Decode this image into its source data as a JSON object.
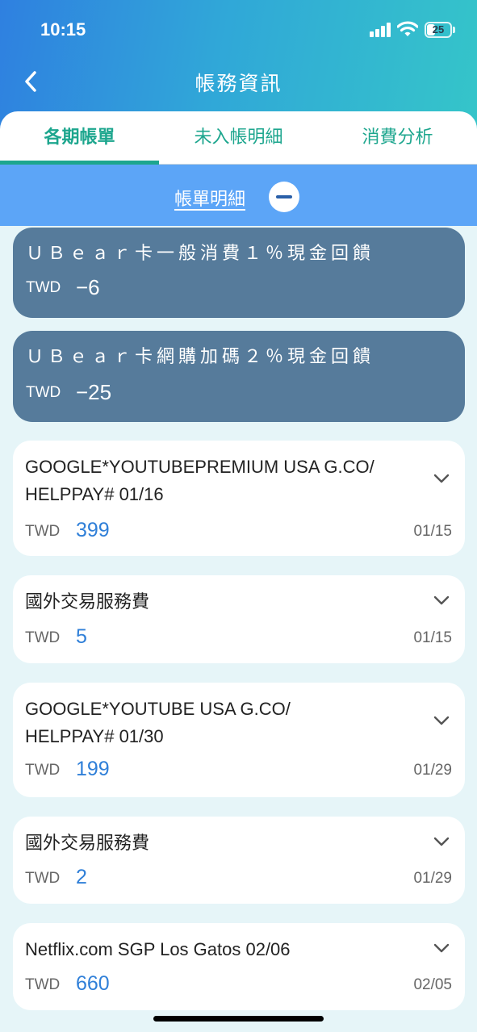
{
  "status_bar": {
    "time": "10:15",
    "battery_level": "25",
    "icons": [
      "signal-icon",
      "wifi-icon",
      "battery-icon"
    ]
  },
  "nav": {
    "title": "帳務資訊",
    "back_icon": "chevron-left-icon"
  },
  "tabs": [
    {
      "label": "各期帳單",
      "active": true
    },
    {
      "label": "未入帳明細",
      "active": false
    },
    {
      "label": "消費分析",
      "active": false
    }
  ],
  "section": {
    "label": "帳單明細",
    "toggle_icon": "minus-circle-icon"
  },
  "rewards": [
    {
      "title": "ＵＢｅａｒ卡一般消費１％現金回饋",
      "currency": "TWD",
      "amount": "−6"
    },
    {
      "title": "ＵＢｅａｒ卡網購加碼２％現金回饋",
      "currency": "TWD",
      "amount": "−25"
    }
  ],
  "transactions": [
    {
      "desc_line1": "GOOGLE*YOUTUBEPREMIUM USA G.CO/",
      "desc_line2": "HELPPAY# 01/16",
      "currency": "TWD",
      "amount": "399",
      "date": "01/15"
    },
    {
      "desc_line1": "國外交易服務費",
      "desc_line2": "",
      "currency": "TWD",
      "amount": "5",
      "date": "01/15"
    },
    {
      "desc_line1": "GOOGLE*YOUTUBE USA G.CO/",
      "desc_line2": "HELPPAY# 01/30",
      "currency": "TWD",
      "amount": "199",
      "date": "01/29"
    },
    {
      "desc_line1": "國外交易服務費",
      "desc_line2": "",
      "currency": "TWD",
      "amount": "2",
      "date": "01/29"
    },
    {
      "desc_line1": "Netflix.com SGP Los Gatos 02/06",
      "desc_line2": "",
      "currency": "TWD",
      "amount": "660",
      "date": "02/05"
    }
  ],
  "colors": {
    "accent_green": "#1da68e",
    "section_blue": "#5ca5f7",
    "reward_bg": "#567b9b",
    "amount_blue": "#2f7fd8"
  }
}
